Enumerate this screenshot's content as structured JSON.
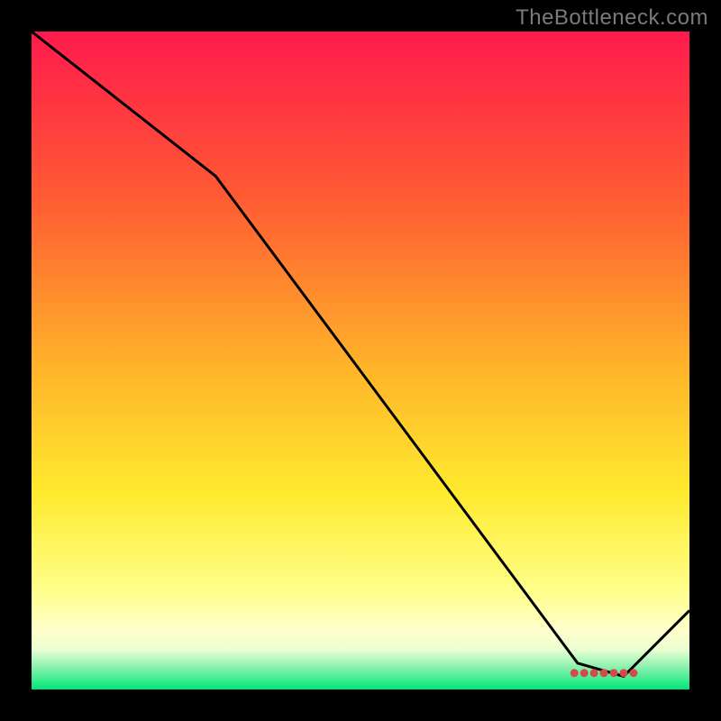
{
  "watermark": "TheBottleneck.com",
  "chart_data": {
    "type": "line",
    "title": "",
    "xlabel": "",
    "ylabel": "",
    "xlim": [
      0,
      100
    ],
    "ylim": [
      0,
      100
    ],
    "grid": false,
    "series": [
      {
        "name": "curve",
        "color": "#000000",
        "x": [
          0,
          28,
          83,
          90,
          100
        ],
        "values": [
          100,
          78,
          4,
          2,
          12
        ]
      }
    ],
    "markers": {
      "name": "dots",
      "color": "#d24a4a",
      "x": [
        82.5,
        84,
        85.5,
        87,
        88.5,
        90,
        91.5
      ],
      "values": [
        2.5,
        2.5,
        2.5,
        2.5,
        2.5,
        2.5,
        2.5
      ]
    },
    "background_gradient": {
      "stops": [
        {
          "offset": 0,
          "color": "#ff1a4d"
        },
        {
          "offset": 25,
          "color": "#ff5a33"
        },
        {
          "offset": 50,
          "color": "#ffb02a"
        },
        {
          "offset": 70,
          "color": "#ffea2e"
        },
        {
          "offset": 85,
          "color": "#ffff8a"
        },
        {
          "offset": 91,
          "color": "#ffffcc"
        },
        {
          "offset": 94,
          "color": "#e9ffd1"
        },
        {
          "offset": 97,
          "color": "#7bf0a8"
        },
        {
          "offset": 100,
          "color": "#00e676"
        }
      ]
    }
  }
}
